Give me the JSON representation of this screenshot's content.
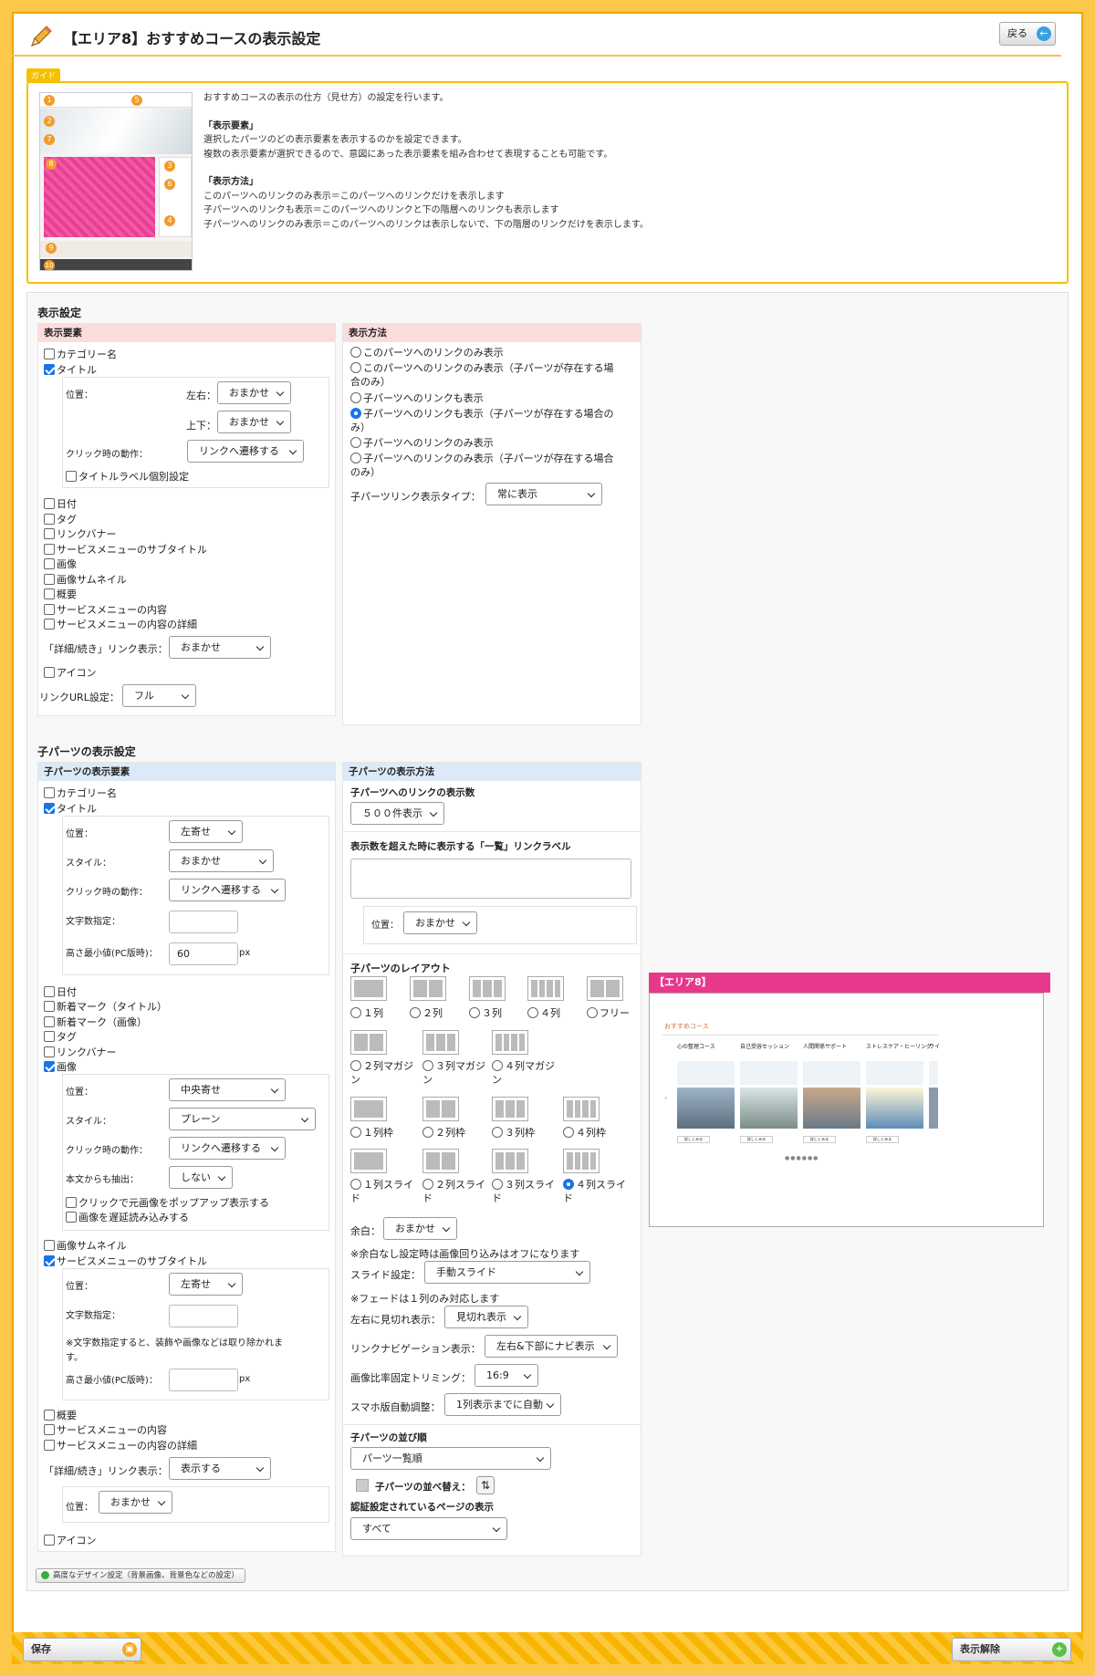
{
  "header": {
    "title": "【エリア8】おすすめコースの表示設定",
    "back_label": "戻る"
  },
  "guide": {
    "tag": "ガイド",
    "intro": "おすすめコースの表示の仕方（見せ方）の設定を行います。",
    "elements_title": "「表示要素」",
    "elements_l1": "選択したパーツのどの表示要素を表示するのかを設定できます。",
    "elements_l2": "複数の表示要素が選択できるので、意図にあった表示要素を組み合わせて表現することも可能です。",
    "method_title": "「表示方法」",
    "method_l1": "このパーツへのリンクのみ表示＝このパーツへのリンクだけを表示します",
    "method_l2": "子パーツへのリンクも表示＝このパーツへのリンクと下の階層へのリンクも表示します",
    "method_l3": "子パーツへのリンクのみ表示＝このパーツへのリンクは表示しないで、下の階層のリンクだけを表示します。",
    "nums": [
      "1",
      "2",
      "3",
      "4",
      "5",
      "6",
      "7",
      "8",
      "9",
      "10"
    ]
  },
  "display": {
    "section_title": "表示設定",
    "elements_header": "表示要素",
    "method_header": "表示方法",
    "category": "カテゴリー名",
    "title": "タイトル",
    "position_label": "位置：",
    "lr_label": "左右：",
    "lr_value": "おまかせ",
    "ud_label": "上下：",
    "ud_value": "おまかせ",
    "click_label": "クリック時の動作：",
    "click_value": "リンクへ遷移する",
    "title_label_individual": "タイトルラベル個別設定",
    "items": [
      "日付",
      "タグ",
      "リンクバナー",
      "サービスメニューのサブタイトル",
      "画像",
      "画像サムネイル",
      "概要",
      "サービスメニューの内容",
      "サービスメニューの内容の詳細"
    ],
    "detail_link_label": "「詳細/続き」リンク表示：",
    "detail_link_value": "おまかせ",
    "icon": "アイコン",
    "link_url_label": "リンクURL設定：",
    "link_url_value": "フル",
    "methods": [
      "このパーツへのリンクのみ表示",
      "このパーツへのリンクのみ表示（子パーツが存在する場",
      "合のみ）",
      "子パーツへのリンクも表示",
      "子パーツへのリンクも表示（子パーツが存在する場合の",
      "み）",
      "子パーツへのリンクのみ表示",
      "子パーツへのリンクのみ表示（子パーツが存在する場合",
      "のみ）"
    ],
    "child_link_type_label": "子パーツリンク表示タイプ：",
    "child_link_type_value": "常に表示"
  },
  "child": {
    "section_title": "子パーツの表示設定",
    "elements_header": "子パーツの表示要素",
    "method_header": "子パーツの表示方法",
    "category": "カテゴリー名",
    "title": "タイトル",
    "pos_label": "位置：",
    "pos_value": "左寄せ",
    "style_label": "スタイル：",
    "style_value": "おまかせ",
    "click_label": "クリック時の動作：",
    "click_value": "リンクへ遷移する",
    "chars_label": "文字数指定：",
    "minh_label": "高さ最小値(PC版時)：",
    "minh_value": "60",
    "px": "px",
    "items1": [
      "日付",
      "新着マーク（タイトル）",
      "新着マーク（画像）",
      "タグ",
      "リンクバナー"
    ],
    "image": "画像",
    "img_pos_value": "中央寄せ",
    "img_style_value": "プレーン",
    "img_click_value": "リンクへ遷移する",
    "extract_label": "本文からも抽出：",
    "extract_value": "しない",
    "popup": "クリックで元画像をポップアップ表示する",
    "lazy": "画像を遅延読み込みする",
    "thumb": "画像サムネイル",
    "subtitle": "サービスメニューのサブタイトル",
    "sub_pos_value": "左寄せ",
    "sub_chars_label": "文字数指定：",
    "sub_note_1": "※文字数指定すると、装飾や画像などは取り除かれま",
    "sub_note_2": "す。",
    "sub_minh_label": "高さ最小値(PC版時)：",
    "items2": [
      "概要",
      "サービスメニューの内容",
      "サービスメニューの内容の詳細"
    ],
    "detail_link_label": "「詳細/続き」リンク表示：",
    "detail_link_value": "表示する",
    "detail_pos_label": "位置：",
    "detail_pos_value": "おまかせ",
    "icon": "アイコン",
    "count_title": "子パーツへのリンクの表示数",
    "count_value": "５００件表示",
    "overflow_title": "表示数を超えた時に表示する「一覧」リンクラベル",
    "overflow_pos_label": "位置：",
    "overflow_pos_value": "おまかせ",
    "layout_title": "子パーツのレイアウト",
    "layouts": [
      "１列",
      "２列",
      "３列",
      "４列",
      "フリー",
      "２列マガジ",
      "ン",
      "３列マガジ",
      "ン",
      "４列マガジ",
      "ン",
      "１列枠",
      "２列枠",
      "３列枠",
      "４列枠",
      "１列スライ",
      "ド",
      "２列スライ",
      "ド",
      "３列スライ",
      "ド",
      "４列スライ",
      "ド"
    ],
    "margin_label": "余白：",
    "margin_value": "おまかせ",
    "margin_note": "※余白なし設定時は画像回り込みはオフになります",
    "slide_label": "スライド設定：",
    "slide_value": "手動スライド",
    "fade_note": "※フェードは１列のみ対応します",
    "cut_label": "左右に見切れ表示：",
    "cut_value": "見切れ表示",
    "nav_label": "リンクナビゲーション表示：",
    "nav_value": "左右&下部にナビ表示",
    "ratio_label": "画像比率固定トリミング：",
    "ratio_value": "16:9",
    "sp_label": "スマホ版自動調整：",
    "sp_value": "1列表示までに自動",
    "order_title": "子パーツの並び順",
    "order_value": "パーツ一覧順",
    "sort_label": "子パーツの並べ替え：",
    "auth_title": "認証設定されているページの表示",
    "auth_value": "すべて"
  },
  "advanced_label": "高度なデザイン設定（背景画像、背景色などの設定）",
  "preview": {
    "header": "【エリア8】",
    "heading": "おすすめコース",
    "cards": [
      "心の整理コース",
      "自己受容セッション",
      "人間関係サポート",
      "ストレスケア・ヒーリング",
      "ライ"
    ],
    "more": "詳しくみる"
  },
  "footer": {
    "save_label": "保存",
    "release_label": "表示解除"
  },
  "colors": {
    "accent": "#f5b400",
    "pink": "#e8388c",
    "blue": "#1a73e8"
  }
}
